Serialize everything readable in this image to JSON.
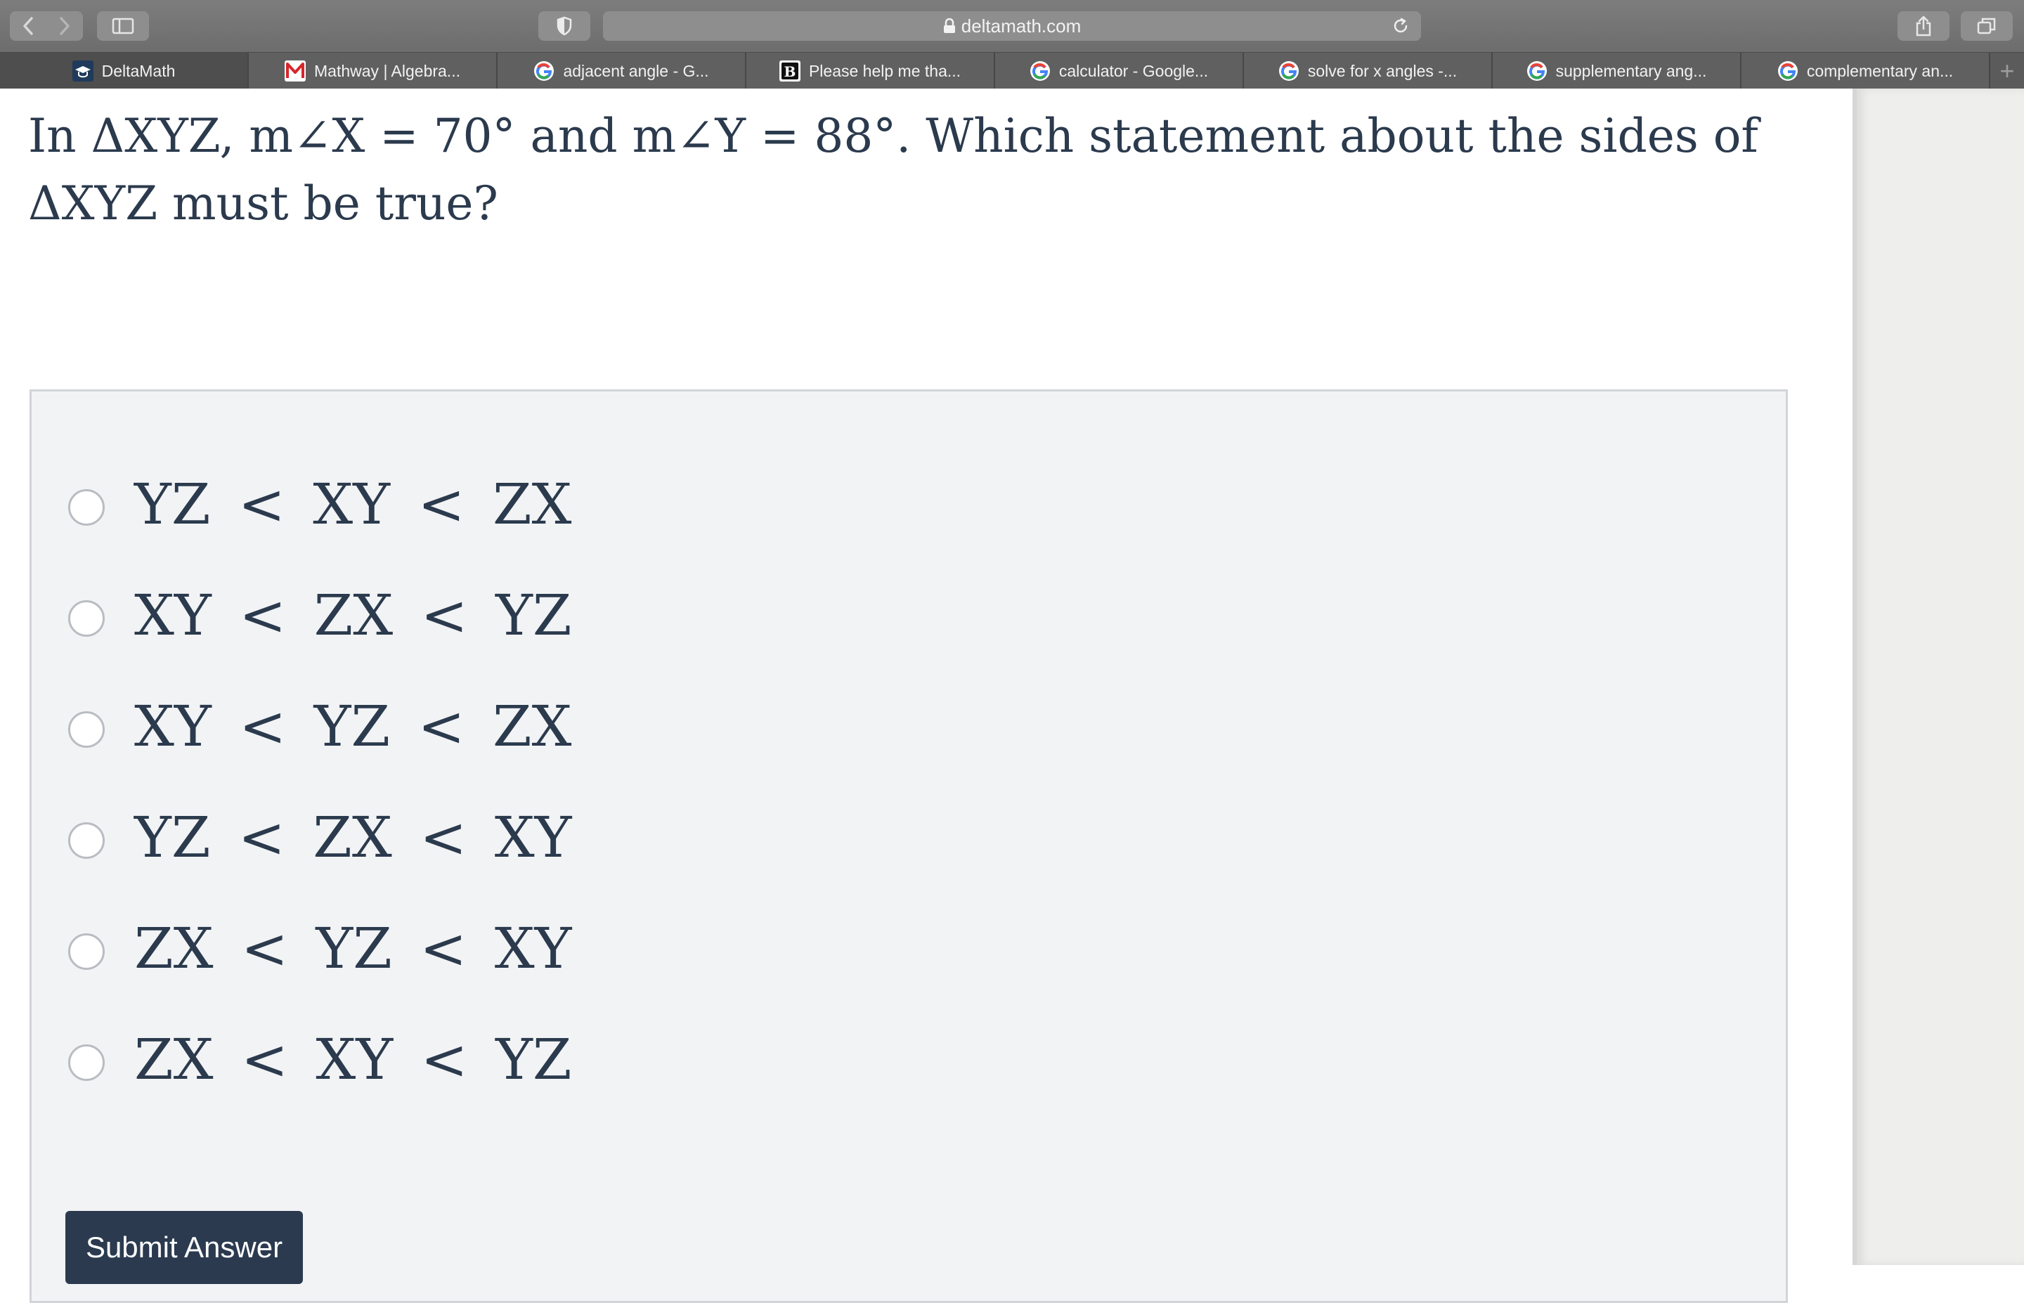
{
  "browser": {
    "url": "deltamath.com",
    "tabs": [
      {
        "label": "DeltaMath",
        "icon": "deltamath-icon",
        "active": true
      },
      {
        "label": "Mathway | Algebra...",
        "icon": "mathway-icon",
        "active": false
      },
      {
        "label": "adjacent angle - G...",
        "icon": "google-icon",
        "active": false
      },
      {
        "label": "Please help me tha...",
        "icon": "brainly-icon",
        "active": false
      },
      {
        "label": "calculator - Google...",
        "icon": "google-icon",
        "active": false
      },
      {
        "label": "solve for x angles -...",
        "icon": "google-icon",
        "active": false
      },
      {
        "label": "supplementary ang...",
        "icon": "google-icon",
        "active": false
      },
      {
        "label": "complementary an...",
        "icon": "google-icon",
        "active": false
      }
    ],
    "new_tab_label": "+"
  },
  "question": {
    "text": "In ΔXYZ, m∠X = 70° and m∠Y = 88°. Which statement about the sides of ΔXYZ must be true?"
  },
  "choices": [
    {
      "label": "YZ < XY < ZX",
      "selected": false
    },
    {
      "label": "XY < ZX < YZ",
      "selected": false
    },
    {
      "label": "XY < YZ < ZX",
      "selected": false
    },
    {
      "label": "YZ < ZX < XY",
      "selected": false
    },
    {
      "label": "ZX < YZ < XY",
      "selected": false
    },
    {
      "label": "ZX < XY < YZ",
      "selected": false
    }
  ],
  "submit": {
    "label": "Submit Answer"
  },
  "colors": {
    "text": "#2b3a4d",
    "button": "#2b3a4f",
    "panel": "#f2f3f5",
    "chrome": "#747474"
  }
}
